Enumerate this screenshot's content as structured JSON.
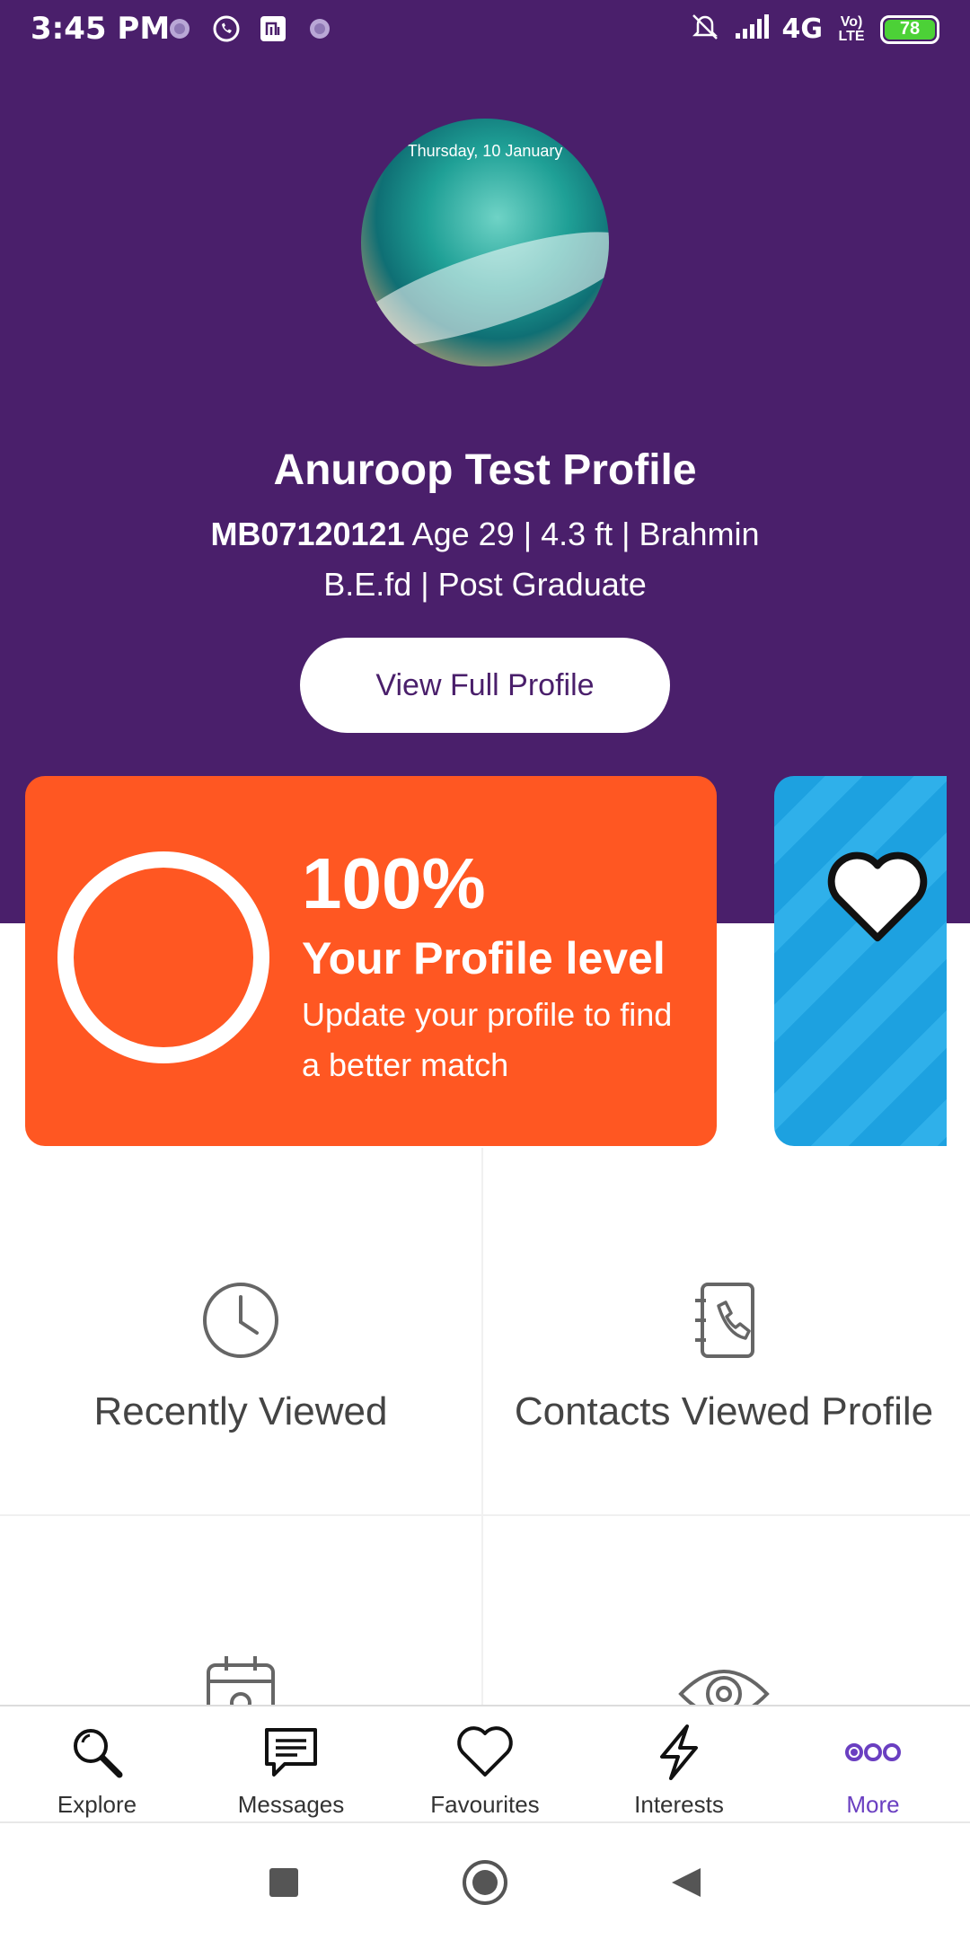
{
  "status_bar": {
    "time": "3:45 PM",
    "network": "4G",
    "volte": "Vo) LTE",
    "battery": "78",
    "icons": [
      "notification-dot-icon",
      "whatsapp-icon",
      "mi-icon",
      "notification-dot-icon",
      "mute-icon",
      "signal-icon"
    ]
  },
  "profile": {
    "avatar_date": "Thursday, 10 January",
    "name": "Anuroop Test Profile",
    "id": "MB07120121",
    "details": "Age 29 | 4.3 ft | Brahmin",
    "education": "B.E.fd | Post Graduate",
    "view_button": "View Full Profile"
  },
  "profile_level": {
    "percent": "100%",
    "title": "Your Profile level",
    "description": "Update your profile to find a better match",
    "progress": 1.0
  },
  "tiles": [
    {
      "label": "Recently Viewed",
      "icon": "clock-icon"
    },
    {
      "label": "Contacts Viewed Profile",
      "icon": "contact-book-icon"
    },
    {
      "label": "",
      "icon": "calendar-icon"
    },
    {
      "label": "",
      "icon": "eye-icon"
    }
  ],
  "bottom_nav": [
    {
      "label": "Explore",
      "icon": "search-icon"
    },
    {
      "label": "Messages",
      "icon": "message-icon"
    },
    {
      "label": "Favourites",
      "icon": "heart-icon"
    },
    {
      "label": "Interests",
      "icon": "lightning-icon"
    },
    {
      "label": "More",
      "icon": "more-icon",
      "active": true
    }
  ],
  "colors": {
    "header": "#4a1f6b",
    "card": "#ff5722",
    "promo": "#1da1e0",
    "active_nav": "#6a3fc1"
  }
}
